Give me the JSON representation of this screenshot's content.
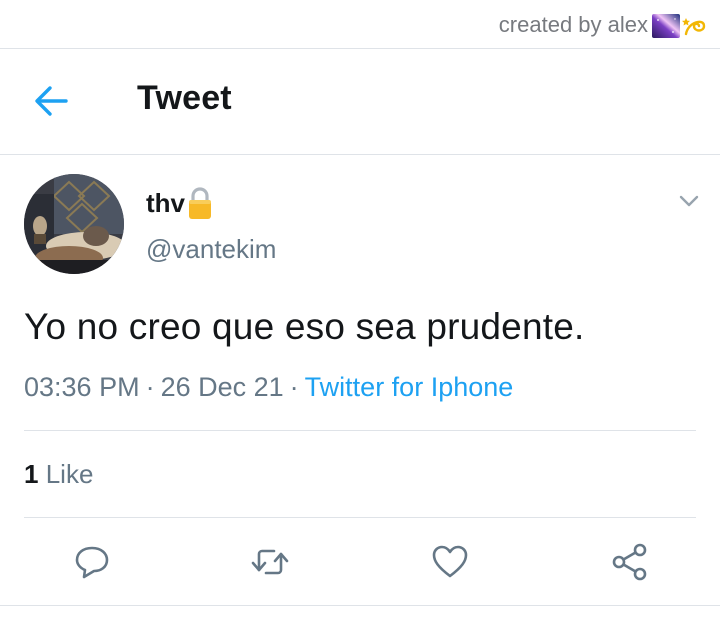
{
  "watermark": {
    "text": "created by alex"
  },
  "header": {
    "title": "Tweet",
    "back_icon": "arrow-left-icon"
  },
  "tweet": {
    "display_name": "thv",
    "handle": "@vantekim",
    "text": "Yo no creo que eso sea prudente.",
    "time": "03:36 PM",
    "date": "26 Dec 21",
    "separator": "·",
    "source": "Twitter for Iphone",
    "like_count": "1",
    "like_label": "Like"
  },
  "actions": [
    "reply-icon",
    "retweet-icon",
    "like-icon",
    "share-icon"
  ],
  "colors": {
    "accent": "#1da1f2",
    "text": "#14171a",
    "secondary": "#657786",
    "border": "#dfe3e8"
  }
}
